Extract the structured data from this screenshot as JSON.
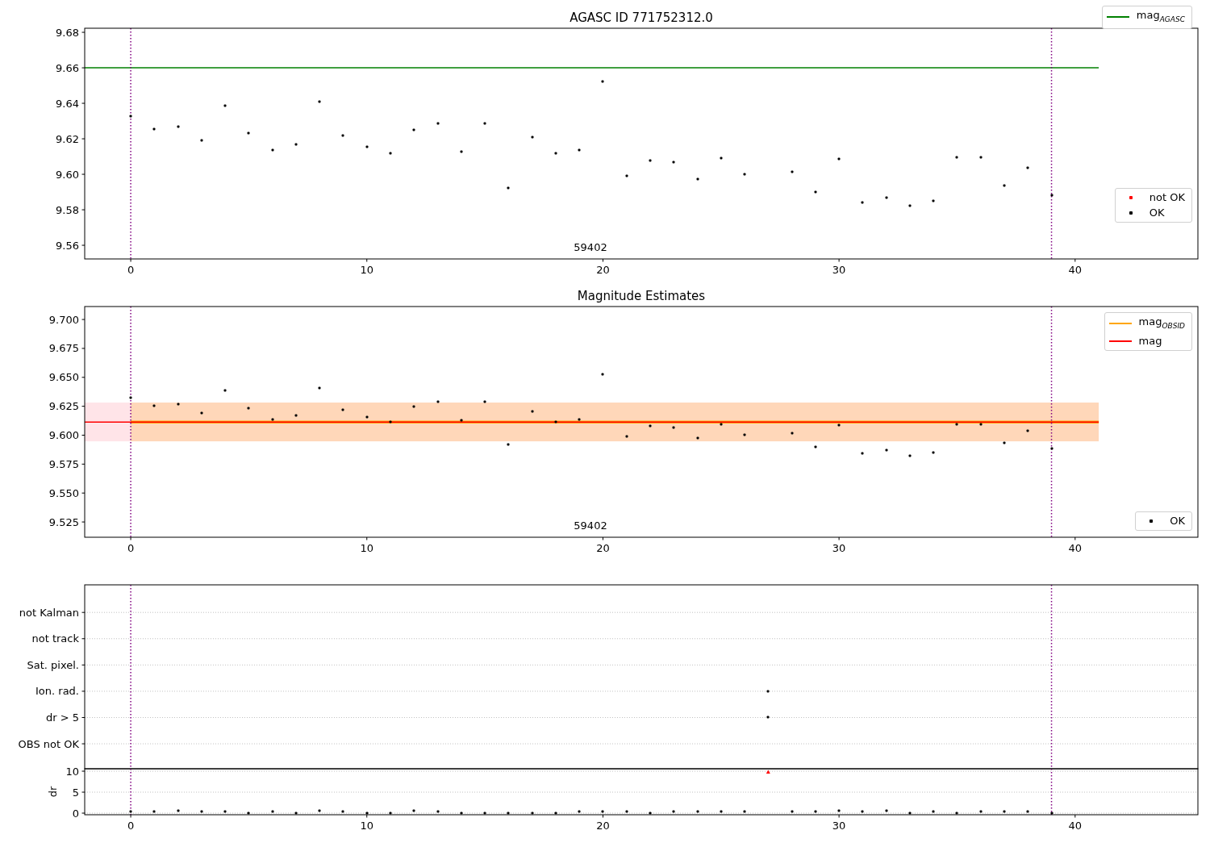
{
  "figure": {
    "axes": [
      {
        "chart_data": {
          "type": "scatter",
          "title": "AGASC ID 771752312.0",
          "xlim": [
            -1.95,
            45.2
          ],
          "ylim": [
            9.5523,
            9.6823
          ],
          "xticks": [
            0,
            10,
            20,
            30,
            40
          ],
          "yticks": [
            {
              "value": 9.56,
              "label": "9.56"
            },
            {
              "value": 9.58,
              "label": "9.58"
            },
            {
              "value": 9.6,
              "label": "9.60"
            },
            {
              "value": 9.62,
              "label": "9.62"
            },
            {
              "value": 9.64,
              "label": "9.64"
            },
            {
              "value": 9.66,
              "label": "9.66"
            },
            {
              "value": 9.68,
              "label": "9.68"
            }
          ],
          "series": [
            {
              "name": "mag$_{AGASC}$",
              "color": "#008000",
              "type": "line",
              "x": [
                -1.95,
                41
              ],
              "values": [
                9.66,
                9.66
              ]
            },
            {
              "name": "not OK",
              "color": "#ff0000",
              "values": [
                null
              ]
            },
            {
              "name": "OK",
              "color": "#000000",
              "x": [
                0,
                1,
                2,
                3,
                4,
                5,
                6,
                7,
                8,
                9,
                10,
                11,
                12,
                13,
                14,
                15,
                16,
                17,
                18,
                19,
                20,
                21,
                22,
                23,
                24,
                25,
                26,
                28,
                29,
                30,
                31,
                32,
                33,
                34,
                35,
                36,
                37,
                38,
                39
              ],
              "values": [
                9.6327,
                9.6255,
                9.6268,
                9.6191,
                9.6386,
                9.6232,
                9.6136,
                9.6168,
                9.6409,
                9.6218,
                9.6155,
                9.6118,
                9.625,
                9.6286,
                9.6127,
                9.6286,
                9.5923,
                9.6209,
                9.6118,
                9.6136,
                9.6523,
                9.5991,
                9.6077,
                9.6068,
                9.5973,
                9.6091,
                9.6,
                9.6014,
                9.59,
                9.6086,
                9.5841,
                9.5868,
                9.5823,
                9.585,
                9.6095,
                9.6095,
                9.5936,
                9.6036,
                9.5882
              ]
            }
          ],
          "legend": "right",
          "ref_lines": [
            {
              "axis": "x",
              "value": 0
            },
            {
              "axis": "x",
              "value": 39
            }
          ],
          "annotations": [
            "59402"
          ]
        }
      },
      {
        "chart_data": {
          "type": "scatter",
          "title": "Magnitude Estimates",
          "xlim": [
            -1.95,
            45.2
          ],
          "ylim": [
            9.5118,
            9.7112
          ],
          "xticks": [
            0,
            10,
            20,
            30,
            40
          ],
          "yticks": [
            {
              "value": 9.525,
              "label": "9.525"
            },
            {
              "value": 9.55,
              "label": "9.550"
            },
            {
              "value": 9.575,
              "label": "9.575"
            },
            {
              "value": 9.6,
              "label": "9.600"
            },
            {
              "value": 9.625,
              "label": "9.625"
            },
            {
              "value": 9.65,
              "label": "9.650"
            },
            {
              "value": 9.675,
              "label": "9.675"
            },
            {
              "value": 9.7,
              "label": "9.700"
            }
          ],
          "series": [
            {
              "name": "mag$_{OBSID}$",
              "color": "#ffa500",
              "type": "line",
              "x": [
                0,
                41
              ],
              "values": [
                9.6114,
                9.6114
              ]
            },
            {
              "name": "mag",
              "color": "#ff0000",
              "type": "line",
              "x": [
                -1.95,
                41
              ],
              "values": [
                9.6114,
                9.6114
              ]
            },
            {
              "name": "OK",
              "color": "#000000",
              "x": [
                0,
                1,
                2,
                3,
                4,
                5,
                6,
                7,
                8,
                9,
                10,
                11,
                12,
                13,
                14,
                15,
                16,
                17,
                18,
                19,
                20,
                21,
                22,
                23,
                24,
                25,
                26,
                28,
                29,
                30,
                31,
                32,
                33,
                34,
                35,
                36,
                37,
                38,
                39
              ],
              "values": [
                9.6327,
                9.6255,
                9.6268,
                9.6191,
                9.6386,
                9.6232,
                9.6136,
                9.6168,
                9.6409,
                9.6218,
                9.6155,
                9.6118,
                9.625,
                9.6286,
                9.6127,
                9.6286,
                9.5923,
                9.6209,
                9.6118,
                9.6136,
                9.6523,
                9.5991,
                9.6077,
                9.6068,
                9.5973,
                9.6091,
                9.6,
                9.6014,
                9.59,
                9.6086,
                9.5841,
                9.5868,
                9.5823,
                9.585,
                9.6095,
                9.6095,
                9.5936,
                9.6036,
                9.5882
              ]
            }
          ],
          "legend": "right",
          "bands": [
            {
              "axis": "y",
              "from": 9.5947,
              "to": 9.6282
            },
            {
              "axis": "y",
              "from": 9.5947,
              "to": 9.6282
            }
          ],
          "ref_lines": [
            {
              "axis": "x",
              "value": 0
            },
            {
              "axis": "x",
              "value": 39
            }
          ],
          "annotations": [
            "59402"
          ]
        }
      },
      {
        "chart_data": {
          "type": "scatter",
          "orientation": "horizontal",
          "xlim": [
            -1.95,
            45.2
          ],
          "categories": [
            "not Kalman",
            "not track",
            "Sat. pixel.",
            "Ion. rad.",
            "dr > 5",
            "OBS not OK"
          ],
          "series": [
            {
              "color": "#000000",
              "values": [
                null,
                null,
                null,
                27,
                27,
                null
              ]
            }
          ],
          "ref_lines": [
            {
              "axis": "x",
              "value": 0
            },
            {
              "axis": "x",
              "value": 39
            }
          ]
        }
      },
      {
        "chart_data": {
          "type": "scatter",
          "ylabel": "dr",
          "xlim": [
            -1.95,
            45.2
          ],
          "ylim": [
            -0.38,
            10.58
          ],
          "xticks": [
            0,
            10,
            20,
            30,
            40
          ],
          "yticks": [
            0,
            5,
            10
          ],
          "series": [
            {
              "color": "#000000",
              "x": [
                0,
                1,
                2,
                3,
                4,
                5,
                6,
                7,
                8,
                9,
                10,
                11,
                12,
                13,
                14,
                15,
                16,
                17,
                18,
                19,
                20,
                21,
                22,
                23,
                24,
                25,
                26,
                28,
                29,
                30,
                31,
                32,
                33,
                34,
                35,
                36,
                37,
                38,
                39
              ],
              "values": [
                0.3,
                0.3,
                0.6,
                0.3,
                0.3,
                0.1,
                0.3,
                0.1,
                0.5,
                0.3,
                0.1,
                0.1,
                0.5,
                0.3,
                0.1,
                0.1,
                0.1,
                0.1,
                0.1,
                0.3,
                0.3,
                0.3,
                0.1,
                0.3,
                0.3,
                0.3,
                0.3,
                0.3,
                0.3,
                0.5,
                0.3,
                0.5,
                0.1,
                0.3,
                0.1,
                0.3,
                0.3,
                0.3,
                0.1
              ]
            },
            {
              "color": "#ff0000",
              "x": [
                27
              ],
              "values": [
                9.8
              ]
            }
          ],
          "ref_lines": [
            {
              "axis": "x",
              "value": 0
            },
            {
              "axis": "x",
              "value": 39
            }
          ]
        }
      }
    ]
  }
}
